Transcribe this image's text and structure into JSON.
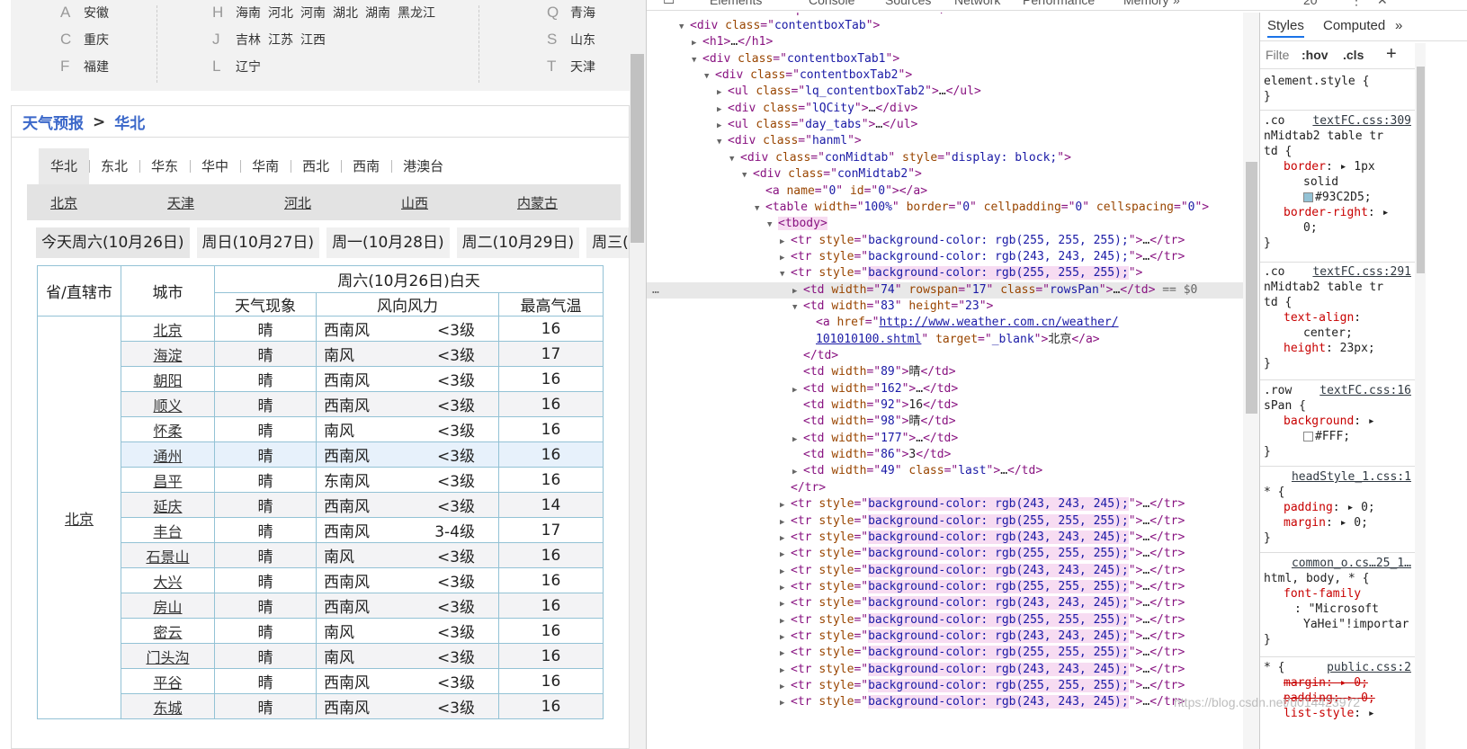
{
  "city_index": {
    "rows": [
      {
        "letter_a": "A",
        "prov_a": [
          "安徽"
        ],
        "letter_b": "H",
        "prov_b": [
          "海南",
          "河北",
          "河南",
          "湖北",
          "湖南",
          "黑龙江"
        ],
        "letter_c": "Q",
        "prov_c": [
          "青海"
        ]
      },
      {
        "letter_a": "C",
        "prov_a": [
          "重庆"
        ],
        "letter_b": "J",
        "prov_b": [
          "吉林",
          "江苏",
          "江西"
        ],
        "letter_c": "S",
        "prov_c": [
          "山东"
        ]
      },
      {
        "letter_a": "F",
        "prov_a": [
          "福建"
        ],
        "letter_b": "L",
        "prov_b": [
          "辽宁"
        ],
        "letter_c": "T",
        "prov_c": [
          "天津"
        ]
      }
    ]
  },
  "breadcrumb": {
    "root": "天气预报",
    "arrow": ">",
    "current": "华北"
  },
  "region_tabs": [
    "华北",
    "东北",
    "华东",
    "华中",
    "华南",
    "西北",
    "西南",
    "港澳台"
  ],
  "province_links": [
    "北京",
    "天津",
    "河北",
    "山西",
    "内蒙古"
  ],
  "day_tabs": [
    "今天周六(10月26日)",
    "周日(10月27日)",
    "周一(10月28日)",
    "周二(10月29日)",
    "周三(1"
  ],
  "table": {
    "h_province": "省/直辖市",
    "h_city": "城市",
    "h_day": "周六(10月26日)白天",
    "h_weather": "天气现象",
    "h_wind": "风向风力",
    "h_high": "最高气温",
    "province": "北京",
    "rows": [
      {
        "city": "北京",
        "weather": "晴",
        "dir": "西南风",
        "lvl": "<3级",
        "high": "16"
      },
      {
        "city": "海淀",
        "weather": "晴",
        "dir": "南风",
        "lvl": "<3级",
        "high": "17"
      },
      {
        "city": "朝阳",
        "weather": "晴",
        "dir": "西南风",
        "lvl": "<3级",
        "high": "16"
      },
      {
        "city": "顺义",
        "weather": "晴",
        "dir": "西南风",
        "lvl": "<3级",
        "high": "16"
      },
      {
        "city": "怀柔",
        "weather": "晴",
        "dir": "南风",
        "lvl": "<3级",
        "high": "16"
      },
      {
        "city": "通州",
        "weather": "晴",
        "dir": "西南风",
        "lvl": "<3级",
        "high": "16"
      },
      {
        "city": "昌平",
        "weather": "晴",
        "dir": "东南风",
        "lvl": "<3级",
        "high": "16"
      },
      {
        "city": "延庆",
        "weather": "晴",
        "dir": "西南风",
        "lvl": "<3级",
        "high": "14"
      },
      {
        "city": "丰台",
        "weather": "晴",
        "dir": "西南风",
        "lvl": "3-4级",
        "high": "17"
      },
      {
        "city": "石景山",
        "weather": "晴",
        "dir": "南风",
        "lvl": "<3级",
        "high": "16"
      },
      {
        "city": "大兴",
        "weather": "晴",
        "dir": "西南风",
        "lvl": "<3级",
        "high": "16"
      },
      {
        "city": "房山",
        "weather": "晴",
        "dir": "西南风",
        "lvl": "<3级",
        "high": "16"
      },
      {
        "city": "密云",
        "weather": "晴",
        "dir": "南风",
        "lvl": "<3级",
        "high": "16"
      },
      {
        "city": "门头沟",
        "weather": "晴",
        "dir": "南风",
        "lvl": "<3级",
        "high": "16"
      },
      {
        "city": "平谷",
        "weather": "晴",
        "dir": "西南风",
        "lvl": "<3级",
        "high": "16"
      },
      {
        "city": "东城",
        "weather": "晴",
        "dir": "西南风",
        "lvl": "<3级",
        "high": "16"
      }
    ]
  },
  "devtools": {
    "tabs": [
      "Elements",
      "Console",
      "Sources",
      "Network",
      "Performance",
      "Memory",
      "»"
    ],
    "badge": "20",
    "elements": [
      {
        "i": 3,
        "t": "▼",
        "h": "<span class='tag'>&lt;div </span><span class='an'>class</span><span class='tag'>=\"</span><span class='av'>contentboxTab</span><span class='tag'>\"&gt;</span>"
      },
      {
        "i": 4,
        "t": "▶",
        "h": "<span class='tag'>&lt;h1&gt;</span><span class='tx'>…</span><span class='tag'>&lt;/h1&gt;</span>"
      },
      {
        "i": 4,
        "t": "▼",
        "h": "<span class='tag'>&lt;div </span><span class='an'>class</span><span class='tag'>=\"</span><span class='av'>contentboxTab1</span><span class='tag'>\"&gt;</span>"
      },
      {
        "i": 5,
        "t": "▼",
        "h": "<span class='tag'>&lt;div </span><span class='an'>class</span><span class='tag'>=\"</span><span class='av'>contentboxTab2</span><span class='tag'>\"&gt;</span>"
      },
      {
        "i": 6,
        "t": "▶",
        "h": "<span class='tag'>&lt;ul </span><span class='an'>class</span><span class='tag'>=\"</span><span class='av'>lq_contentboxTab2</span><span class='tag'>\"&gt;</span><span class='tx'>…</span><span class='tag'>&lt;/ul&gt;</span>"
      },
      {
        "i": 6,
        "t": "▶",
        "h": "<span class='tag'>&lt;div </span><span class='an'>class</span><span class='tag'>=\"</span><span class='av'>lQCity</span><span class='tag'>\"&gt;</span><span class='tx'>…</span><span class='tag'>&lt;/div&gt;</span>"
      },
      {
        "i": 6,
        "t": "▶",
        "h": "<span class='tag'>&lt;ul </span><span class='an'>class</span><span class='tag'>=\"</span><span class='av'>day_tabs</span><span class='tag'>\"&gt;</span><span class='tx'>…</span><span class='tag'>&lt;/ul&gt;</span>"
      },
      {
        "i": 6,
        "t": "▼",
        "h": "<span class='tag'>&lt;div </span><span class='an'>class</span><span class='tag'>=\"</span><span class='av'>hanml</span><span class='tag'>\"&gt;</span>"
      },
      {
        "i": 7,
        "t": "▼",
        "h": "<span class='tag'>&lt;div </span><span class='an'>class</span><span class='tag'>=\"</span><span class='av'>conMidtab</span><span class='tag'>\" </span><span class='an'>style</span><span class='tag'>=\"</span><span class='av'>display: block;</span><span class='tag'>\"&gt;</span>"
      },
      {
        "i": 8,
        "t": "▼",
        "h": "<span class='tag'>&lt;div </span><span class='an'>class</span><span class='tag'>=\"</span><span class='av'>conMidtab2</span><span class='tag'>\"&gt;</span>"
      },
      {
        "i": 9,
        "t": "",
        "h": "<span class='tag'>&lt;a </span><span class='an'>name</span><span class='tag'>=\"</span><span class='av'>0</span><span class='tag'>\" </span><span class='an'>id</span><span class='tag'>=\"</span><span class='av'>0</span><span class='tag'>\"&gt;&lt;/a&gt;</span>"
      },
      {
        "i": 9,
        "t": "▼",
        "h": "<span class='tag'>&lt;table </span><span class='an'>width</span><span class='tag'>=\"</span><span class='av'>100%</span><span class='tag'>\" </span><span class='an'>border</span><span class='tag'>=\"</span><span class='av'>0</span><span class='tag'>\" </span><span class='an'>cellpadding</span><span class='tag'>=\"</span><span class='av'>0</span><span class='tag'>\" </span><span class='an'>cellspacing</span><span class='tag'>=\"</span><span class='av'>0</span><span class='tag'>\"&gt;</span>"
      },
      {
        "i": 10,
        "t": "▼",
        "h": "<span class='tbodyw'>&lt;tbody&gt;</span>"
      },
      {
        "i": 11,
        "t": "▶",
        "h": "<span class='tag'>&lt;tr </span><span class='an'>style</span><span class='tag'>=\"</span><span class='av'>background-color: rgb(255, 255, 255);</span><span class='tag'>\"&gt;</span><span class='tx'>…</span><span class='tag'>&lt;/tr&gt;</span>"
      },
      {
        "i": 11,
        "t": "▶",
        "h": "<span class='tag'>&lt;tr </span><span class='an'>style</span><span class='tag'>=\"</span><span class='av'>background-color: rgb(243, 243, 245);</span><span class='tag'>\"&gt;</span><span class='tx'>…</span><span class='tag'>&lt;/tr&gt;</span>"
      },
      {
        "i": 11,
        "t": "▼",
        "h": "<span class='tag'>&lt;tr </span><span class='an'>style</span><span class='tag'>=\"</span><span class='avh'>background-color: rgb(255, 255, 255);</span><span class='tag'>\"&gt;</span>"
      },
      {
        "i": 12,
        "t": "▶",
        "sel": true,
        "h": "<span class='tag'>&lt;td </span><span class='an'>width</span><span class='tag'>=\"</span><span class='av'>74</span><span class='tag'>\" </span><span class='an'>rowspan</span><span class='tag'>=\"</span><span class='av'>17</span><span class='tag'>\" </span><span class='an'>class</span><span class='tag'>=\"</span><span class='av'>rowsPan</span><span class='tag'>\"&gt;</span><span class='tx'>…</span><span class='tag'>&lt;/td&gt;</span><span class='dollar'> == $0</span>"
      },
      {
        "i": 12,
        "t": "▼",
        "h": "<span class='tag'>&lt;td </span><span class='an'>width</span><span class='tag'>=\"</span><span class='av'>83</span><span class='tag'>\" </span><span class='an'>height</span><span class='tag'>=\"</span><span class='av'>23</span><span class='tag'>\"&gt;</span>"
      },
      {
        "i": 13,
        "t": "",
        "h": "<span class='tag'>&lt;a </span><span class='an'>href</span><span class='tag'>=\"</span><span class='lk'>http://www.weather.com.cn/weather/</span>"
      },
      {
        "i": 13,
        "t": "",
        "h": "<span class='lk'>101010100.shtml</span><span class='tag'>\" </span><span class='an'>target</span><span class='tag'>=\"</span><span class='av'>_blank</span><span class='tag'>\"&gt;</span><span class='tx'>北京</span><span class='tag'>&lt;/a&gt;</span>"
      },
      {
        "i": 12,
        "t": "",
        "h": "<span class='tag'>&lt;/td&gt;</span>"
      },
      {
        "i": 12,
        "t": "",
        "h": "<span class='tag'>&lt;td </span><span class='an'>width</span><span class='tag'>=\"</span><span class='av'>89</span><span class='tag'>\"&gt;</span><span class='tx'>晴</span><span class='tag'>&lt;/td&gt;</span>"
      },
      {
        "i": 12,
        "t": "▶",
        "h": "<span class='tag'>&lt;td </span><span class='an'>width</span><span class='tag'>=\"</span><span class='av'>162</span><span class='tag'>\"&gt;</span><span class='tx'>…</span><span class='tag'>&lt;/td&gt;</span>"
      },
      {
        "i": 12,
        "t": "",
        "h": "<span class='tag'>&lt;td </span><span class='an'>width</span><span class='tag'>=\"</span><span class='av'>92</span><span class='tag'>\"&gt;</span><span class='tx'>16</span><span class='tag'>&lt;/td&gt;</span>"
      },
      {
        "i": 12,
        "t": "",
        "h": "<span class='tag'>&lt;td </span><span class='an'>width</span><span class='tag'>=\"</span><span class='av'>98</span><span class='tag'>\"&gt;</span><span class='tx'>晴</span><span class='tag'>&lt;/td&gt;</span>"
      },
      {
        "i": 12,
        "t": "▶",
        "h": "<span class='tag'>&lt;td </span><span class='an'>width</span><span class='tag'>=\"</span><span class='av'>177</span><span class='tag'>\"&gt;</span><span class='tx'>…</span><span class='tag'>&lt;/td&gt;</span>"
      },
      {
        "i": 12,
        "t": "",
        "h": "<span class='tag'>&lt;td </span><span class='an'>width</span><span class='tag'>=\"</span><span class='av'>86</span><span class='tag'>\"&gt;</span><span class='tx'>3</span><span class='tag'>&lt;/td&gt;</span>"
      },
      {
        "i": 12,
        "t": "▶",
        "h": "<span class='tag'>&lt;td </span><span class='an'>width</span><span class='tag'>=\"</span><span class='av'>49</span><span class='tag'>\" </span><span class='an'>class</span><span class='tag'>=\"</span><span class='av'>last</span><span class='tag'>\"&gt;</span><span class='tx'>…</span><span class='tag'>&lt;/td&gt;</span>"
      },
      {
        "i": 11,
        "t": "",
        "h": "<span class='tag'>&lt;/tr&gt;</span>"
      },
      {
        "i": 11,
        "t": "▶",
        "h": "<span class='tag'>&lt;tr </span><span class='an'>style</span><span class='tag'>=\"</span><span class='avh'>background-color: rgb(243, 243, 245);</span><span class='tag'>\"&gt;</span><span class='tx'>…</span><span class='tag'>&lt;/tr&gt;</span>"
      },
      {
        "i": 11,
        "t": "▶",
        "h": "<span class='tag'>&lt;tr </span><span class='an'>style</span><span class='tag'>=\"</span><span class='avh'>background-color: rgb(255, 255, 255);</span><span class='tag'>\"&gt;</span><span class='tx'>…</span><span class='tag'>&lt;/tr&gt;</span>"
      },
      {
        "i": 11,
        "t": "▶",
        "h": "<span class='tag'>&lt;tr </span><span class='an'>style</span><span class='tag'>=\"</span><span class='avh'>background-color: rgb(243, 243, 245);</span><span class='tag'>\"&gt;</span><span class='tx'>…</span><span class='tag'>&lt;/tr&gt;</span>"
      },
      {
        "i": 11,
        "t": "▶",
        "h": "<span class='tag'>&lt;tr </span><span class='an'>style</span><span class='tag'>=\"</span><span class='avh'>background-color: rgb(255, 255, 255);</span><span class='tag'>\"&gt;</span><span class='tx'>…</span><span class='tag'>&lt;/tr&gt;</span>"
      },
      {
        "i": 11,
        "t": "▶",
        "h": "<span class='tag'>&lt;tr </span><span class='an'>style</span><span class='tag'>=\"</span><span class='avh'>background-color: rgb(243, 243, 245);</span><span class='tag'>\"&gt;</span><span class='tx'>…</span><span class='tag'>&lt;/tr&gt;</span>"
      },
      {
        "i": 11,
        "t": "▶",
        "h": "<span class='tag'>&lt;tr </span><span class='an'>style</span><span class='tag'>=\"</span><span class='avh'>background-color: rgb(255, 255, 255);</span><span class='tag'>\"&gt;</span><span class='tx'>…</span><span class='tag'>&lt;/tr&gt;</span>"
      },
      {
        "i": 11,
        "t": "▶",
        "h": "<span class='tag'>&lt;tr </span><span class='an'>style</span><span class='tag'>=\"</span><span class='avh'>background-color: rgb(243, 243, 245);</span><span class='tag'>\"&gt;</span><span class='tx'>…</span><span class='tag'>&lt;/tr&gt;</span>"
      },
      {
        "i": 11,
        "t": "▶",
        "h": "<span class='tag'>&lt;tr </span><span class='an'>style</span><span class='tag'>=\"</span><span class='avh'>background-color: rgb(255, 255, 255);</span><span class='tag'>\"&gt;</span><span class='tx'>…</span><span class='tag'>&lt;/tr&gt;</span>"
      },
      {
        "i": 11,
        "t": "▶",
        "h": "<span class='tag'>&lt;tr </span><span class='an'>style</span><span class='tag'>=\"</span><span class='avh'>background-color: rgb(243, 243, 245);</span><span class='tag'>\"&gt;</span><span class='tx'>…</span><span class='tag'>&lt;/tr&gt;</span>"
      },
      {
        "i": 11,
        "t": "▶",
        "h": "<span class='tag'>&lt;tr </span><span class='an'>style</span><span class='tag'>=\"</span><span class='avh'>background-color: rgb(255, 255, 255);</span><span class='tag'>\"&gt;</span><span class='tx'>…</span><span class='tag'>&lt;/tr&gt;</span>"
      },
      {
        "i": 11,
        "t": "▶",
        "h": "<span class='tag'>&lt;tr </span><span class='an'>style</span><span class='tag'>=\"</span><span class='avh'>background-color: rgb(243, 243, 245);</span><span class='tag'>\"&gt;</span><span class='tx'>…</span><span class='tag'>&lt;/tr&gt;</span>"
      },
      {
        "i": 11,
        "t": "▶",
        "h": "<span class='tag'>&lt;tr </span><span class='an'>style</span><span class='tag'>=\"</span><span class='avh'>background-color: rgb(255, 255, 255);</span><span class='tag'>\"&gt;</span><span class='tx'>…</span><span class='tag'>&lt;/tr&gt;</span>"
      },
      {
        "i": 11,
        "t": "▶",
        "h": "<span class='tag'>&lt;tr </span><span class='an'>style</span><span class='tag'>=\"</span><span class='avh'>background-color: rgb(243, 243, 245);</span><span class='tag'>\"&gt;</span><span class='tx'>…</span><span class='tag'>&lt;/tr&gt;</span>"
      }
    ],
    "styles_tabs": [
      "Styles",
      "Computed",
      "»"
    ],
    "filter_placeholder": "Filte",
    "hov": ":hov",
    "cls": ".cls",
    "plus": "+",
    "element_style": "element.style {",
    "close_brace": "}",
    "rule1_sel": ".co",
    "rule1_src": "textFC.css:309",
    "rule1_sel2": "nMidtab2 table tr",
    "rule1_sel3": "td {",
    "rule1_p1": "border",
    "rule1_v1": "1px",
    "rule1_v1b": "solid",
    "rule1_v1c": "#93C2D5;",
    "rule1_p2": "border-right",
    "rule1_v2": "0;",
    "rule2_sel": ".co",
    "rule2_src": "textFC.css:291",
    "rule2_sel2": "nMidtab2 table tr",
    "rule2_sel3": "td {",
    "rule2_p1": "text-align",
    "rule2_v1": "center;",
    "rule2_p2": "height",
    "rule2_v2": "23px;",
    "rule3_sel": ".row",
    "rule3_src": "textFC.css:16",
    "rule3_sel2": "sPan {",
    "rule3_p1": "background",
    "rule3_v1": "#FFF;",
    "rule4_src": "headStyle_1.css:1",
    "rule4_sel": "* {",
    "rule4_p1": "padding",
    "rule4_v1": "0;",
    "rule4_p2": "margin",
    "rule4_v2": "0;",
    "rule5_src": "common_o.cs…25_1…",
    "rule5_sel": "html, body, * {",
    "rule5_p1": "font-family",
    "rule5_v1": ": \"Microsoft",
    "rule5_v1b": "YaHei\"!importar",
    "rule6_sel": "* {",
    "rule6_src": "public.css:2",
    "rule6_p1": "margin",
    "rule6_v1": "0;",
    "rule6_p2": "padding",
    "rule6_v2": "0;",
    "rule6_p3": "list-style",
    "watermark": "https://blog.csdn.net/u014423972",
    "more_dots": "⋮",
    "close_x": "✕"
  }
}
